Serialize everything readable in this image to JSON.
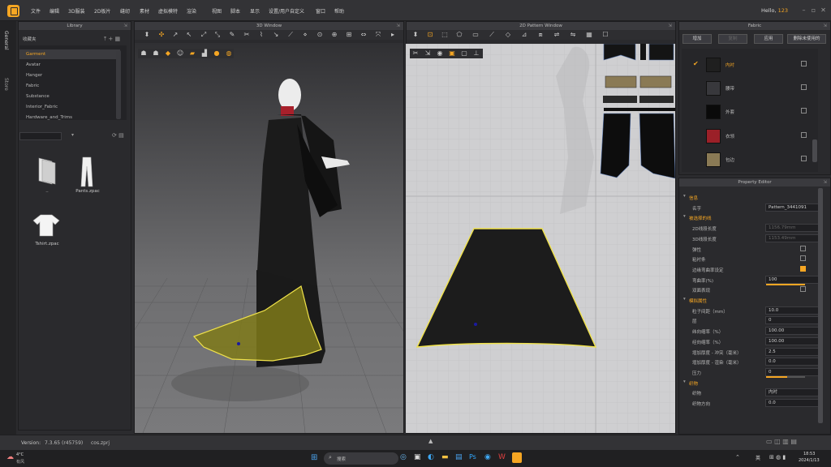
{
  "menubar": {
    "items": [
      "文件",
      "编辑",
      "3D服装",
      "2D板片",
      "缝纫",
      "素材",
      "虚拟模特",
      "渲染",
      "视图",
      "脚本",
      "显示",
      "设置/用户自定义",
      "窗口",
      "帮助"
    ],
    "greeting": "Hello,",
    "user": "123"
  },
  "sidetabs": [
    "General",
    "Store"
  ],
  "library": {
    "title": "Library",
    "favorites": "收藏夹",
    "items": [
      "Garment",
      "Avatar",
      "Hanger",
      "Fabric",
      "Substance",
      "Interior_Fabric",
      "Hardware_and_Trims"
    ],
    "selected_index": 0,
    "files": [
      {
        "label": "..",
        "icon": "folder-up-icon"
      },
      {
        "label": "Pants.zpac",
        "icon": "pants-icon"
      },
      {
        "label": "Tshirt.zpac",
        "icon": "tshirt-icon"
      }
    ]
  },
  "window3d": {
    "title": "3D Window"
  },
  "window2d": {
    "title": "2D Pattern Window"
  },
  "fabric": {
    "title": "Fabric",
    "buttons": [
      "增加",
      "复制",
      "应用",
      "删除未使用的"
    ],
    "items": [
      {
        "name": "内衬",
        "color": "#1f1f1f",
        "current": true
      },
      {
        "name": "腰带",
        "color": "#38383c",
        "current": false
      },
      {
        "name": "外套",
        "color": "#0a0a0a",
        "current": false
      },
      {
        "name": "衣领",
        "color": "#9b2028",
        "current": false
      },
      {
        "name": "包边",
        "color": "#8a7a55",
        "current": false
      }
    ]
  },
  "property": {
    "title": "Property Editor",
    "rows": [
      {
        "key": "信息",
        "value": "",
        "section": true
      },
      {
        "key": "名字",
        "value": "Pattern_3441091"
      },
      {
        "key": "被选择的线",
        "value": "",
        "section": true
      },
      {
        "key": "2D线段长度",
        "value": "1156.79mm",
        "dim": true
      },
      {
        "key": "3D线段长度",
        "value": "1153.49mm",
        "dim": true
      },
      {
        "key": "弹性",
        "value": "",
        "check": false
      },
      {
        "key": "粘衬条",
        "value": "",
        "check": false
      },
      {
        "key": "边缘弯曲率设定",
        "value": "",
        "check": true
      },
      {
        "key": "弯曲率(%)",
        "value": "100",
        "slider": 1.0
      },
      {
        "key": "双面表现",
        "value": "",
        "check": false
      },
      {
        "key": "模拟属性",
        "value": "",
        "section": true
      },
      {
        "key": "粒子间距（mm）",
        "value": "10.0"
      },
      {
        "key": "层",
        "value": "0"
      },
      {
        "key": "纬向缩率（%）",
        "value": "100.00"
      },
      {
        "key": "经向缩率（%）",
        "value": "100.00"
      },
      {
        "key": "增加厚度 - 冲突（毫米）",
        "value": "2.5"
      },
      {
        "key": "增加厚度 - 渲染（毫米）",
        "value": "0.0"
      },
      {
        "key": "压力",
        "value": "0",
        "slider": 0.55
      },
      {
        "key": "织物",
        "value": "",
        "section": true
      },
      {
        "key": "织物",
        "value": "内衬"
      },
      {
        "key": "织物方向",
        "value": "0.0"
      }
    ]
  },
  "status": {
    "version_label": "Version:",
    "version": "7.3.65 (r45759)",
    "file": "cos.zprj"
  },
  "taskbar": {
    "weather": "4°C",
    "weather_desc": "有风",
    "search": "搜索",
    "time": "18:53",
    "date": "2024/1/13",
    "lang": "英"
  }
}
